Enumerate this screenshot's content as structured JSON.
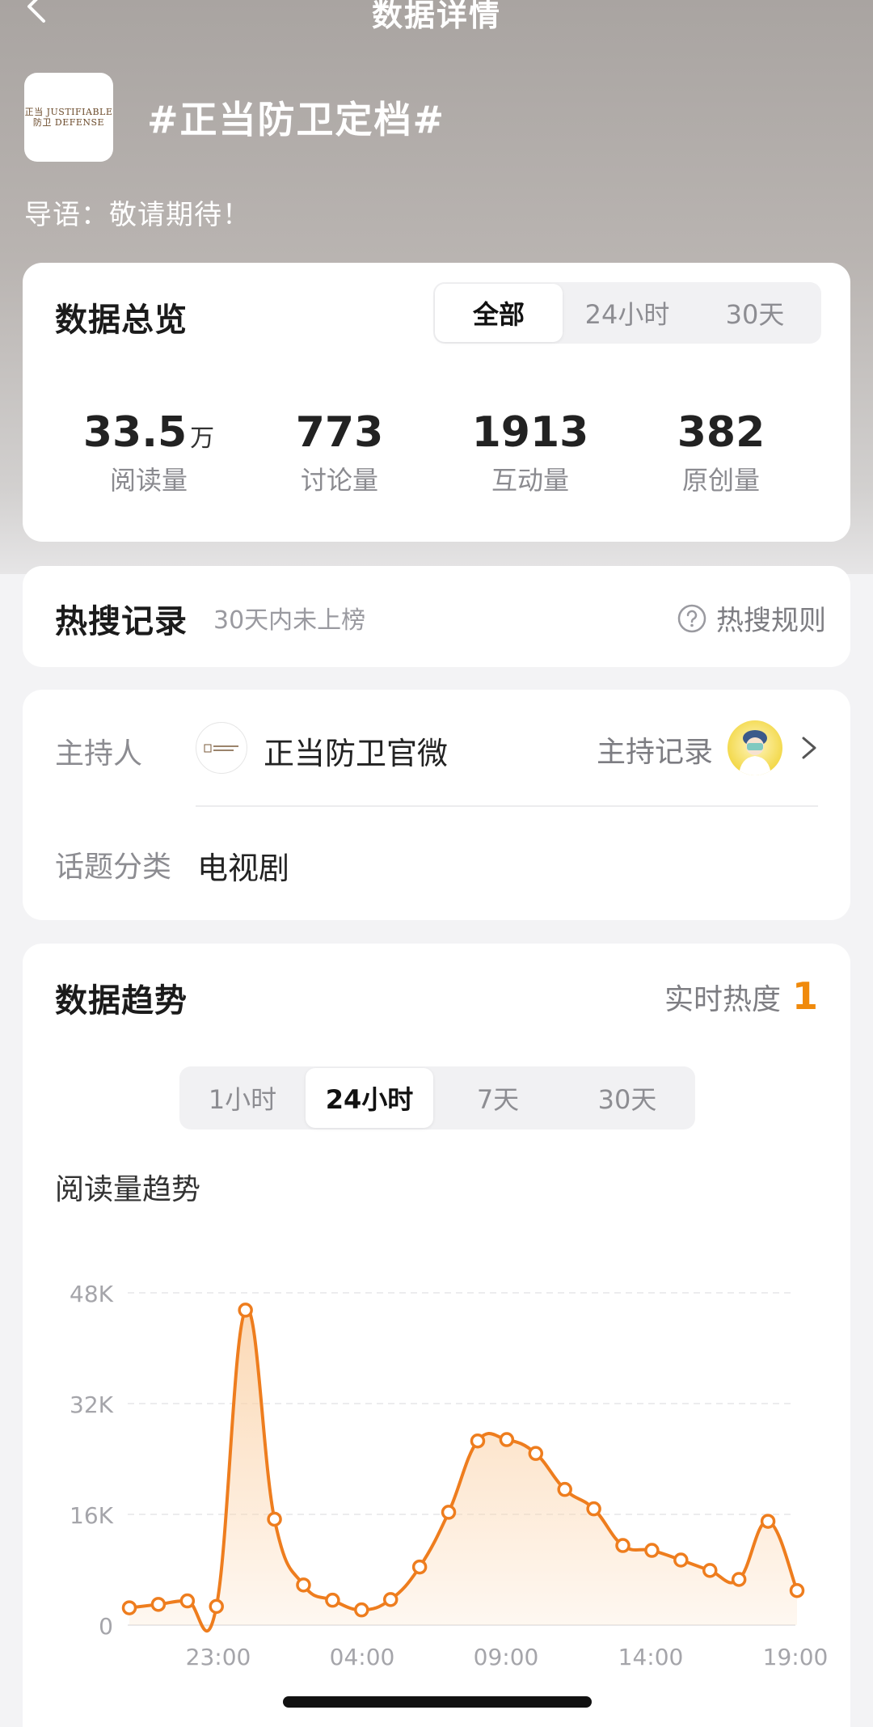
{
  "nav": {
    "title": "数据详情"
  },
  "topic": {
    "logo_text_line1": "正当 JUSTIFIABLE",
    "logo_text_line2": "防卫 DEFENSE",
    "title": "#正当防卫定档#",
    "intro": "导语：敬请期待！"
  },
  "overview": {
    "title": "数据总览",
    "tabs": [
      "全部",
      "24小时",
      "30天"
    ],
    "active_tab": "全部",
    "stats": [
      {
        "value": "33.5",
        "unit": "万",
        "label": "阅读量"
      },
      {
        "value": "773",
        "unit": "",
        "label": "讨论量"
      },
      {
        "value": "1913",
        "unit": "",
        "label": "互动量"
      },
      {
        "value": "382",
        "unit": "",
        "label": "原创量"
      }
    ]
  },
  "hot_search": {
    "title": "热搜记录",
    "subtitle": "30天内未上榜",
    "rules_label": "热搜规则"
  },
  "host": {
    "host_label": "主持人",
    "host_name": "正当防卫官微",
    "record_label": "主持记录",
    "category_label": "话题分类",
    "category_value": "电视剧"
  },
  "trend": {
    "title": "数据趋势",
    "realtime_label": "实时热度",
    "realtime_value": "1",
    "tabs": [
      "1小时",
      "24小时",
      "7天",
      "30天"
    ],
    "active_tab": "24小时",
    "chart_title": "阅读量趋势"
  },
  "colors": {
    "accent": "#f08a0c",
    "line": "#ee7d1e",
    "area_top": "#fbd2a8"
  },
  "chart_data": {
    "type": "line",
    "title": "阅读量趋势",
    "xlabel": "",
    "ylabel": "",
    "x_tick_labels": [
      "23:00",
      "04:00",
      "09:00",
      "14:00",
      "19:00"
    ],
    "y_tick_labels": [
      "0",
      "16K",
      "32K",
      "48K"
    ],
    "ylim": [
      0,
      48000
    ],
    "grid": true,
    "series": [
      {
        "name": "",
        "values": [
          2500,
          3000,
          3500,
          2700,
          45500,
          15300,
          5800,
          3600,
          2200,
          3700,
          8400,
          16300,
          26600,
          26800,
          24800,
          19600,
          16800,
          11500,
          10800,
          9400,
          7900,
          6600,
          15000,
          5000
        ]
      }
    ]
  }
}
